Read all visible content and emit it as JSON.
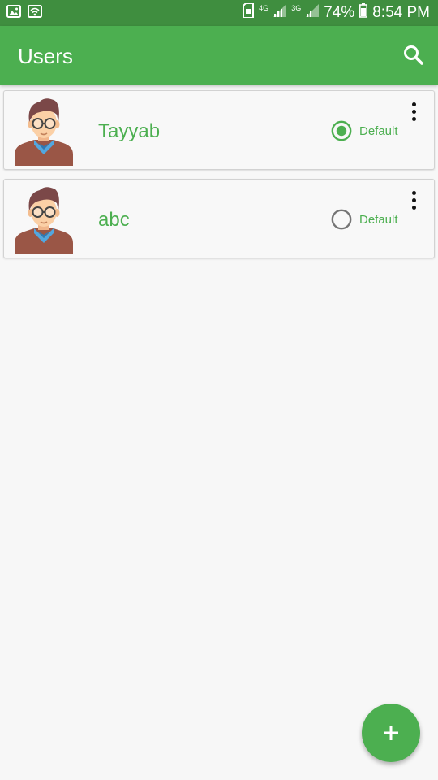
{
  "status_bar": {
    "battery": "74%",
    "time": "8:54 PM",
    "network_1": "4G",
    "network_2": "3G",
    "icons": [
      "image-icon",
      "wifi-icon",
      "sim-icon",
      "signal-icon",
      "signal-icon",
      "battery-icon"
    ]
  },
  "app_bar": {
    "title": "Users",
    "search_icon": "search-icon"
  },
  "users": [
    {
      "name": "Tayyab",
      "default_label": "Default",
      "is_default": true
    },
    {
      "name": "abc",
      "default_label": "Default",
      "is_default": false
    }
  ],
  "fab": {
    "icon": "plus-icon",
    "glyph": "+"
  },
  "colors": {
    "primary": "#4caf50",
    "status_bar": "#3f8e3f",
    "radio_unselected": "#757575",
    "background": "#f7f7f7"
  }
}
